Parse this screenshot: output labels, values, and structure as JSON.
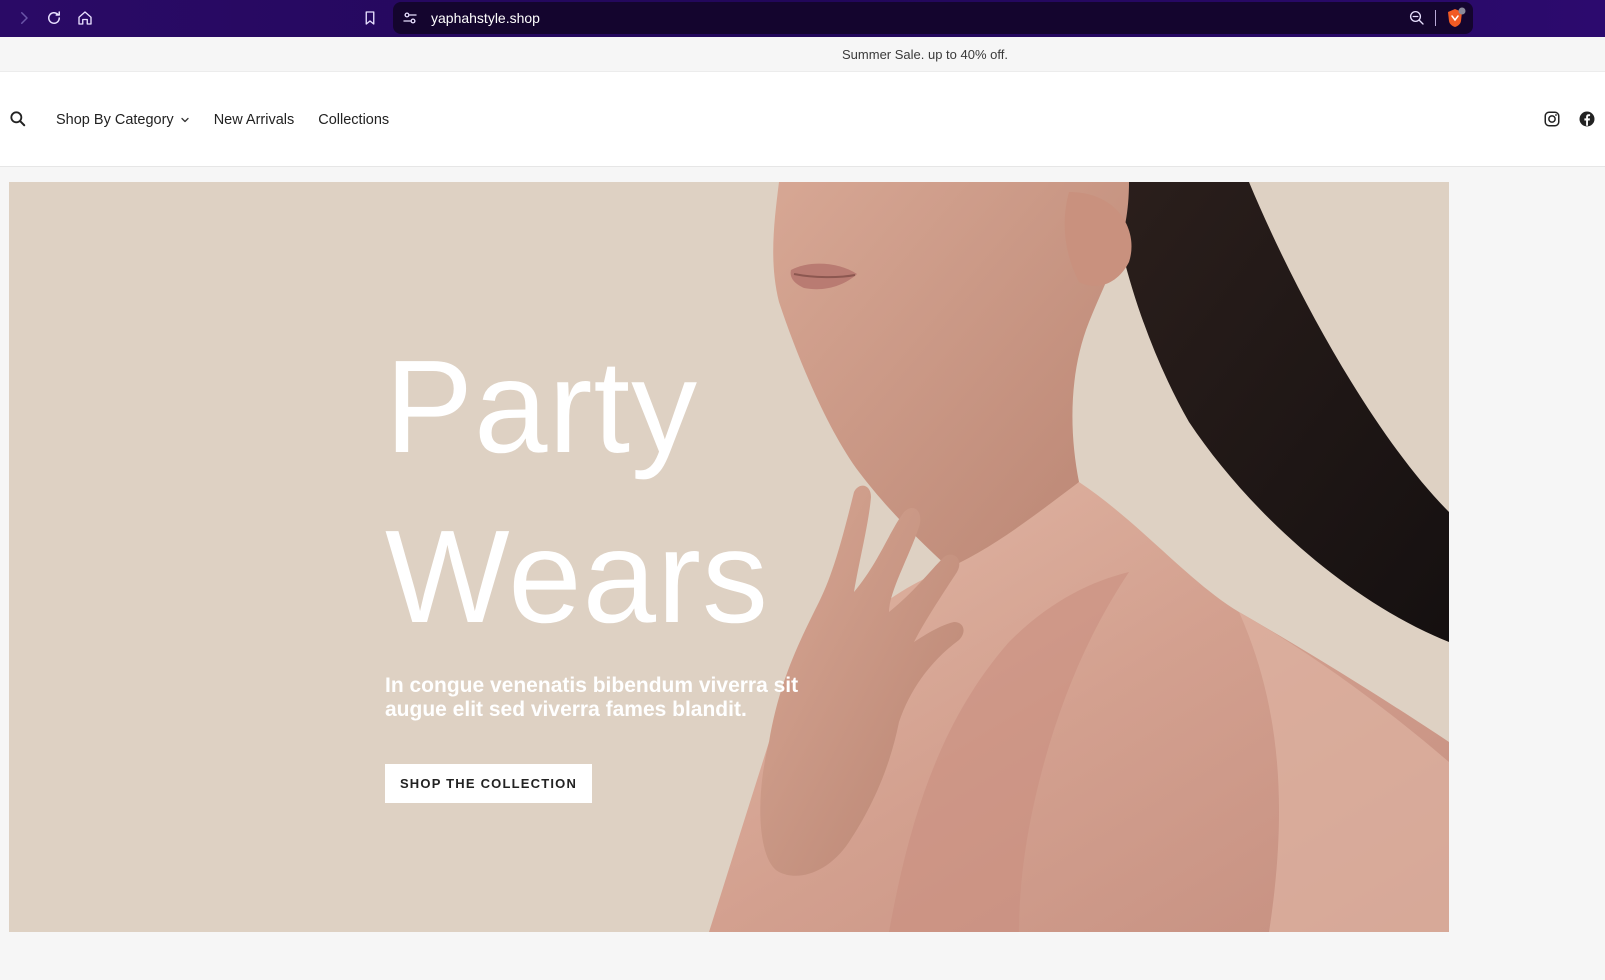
{
  "browser": {
    "url": "yaphahstyle.shop",
    "accent": "#2a0a66"
  },
  "announcement": {
    "text": "Summer Sale. up to 40% off."
  },
  "header": {
    "nav": [
      {
        "label": "Shop By Category",
        "has_dropdown": true
      },
      {
        "label": "New Arrivals"
      },
      {
        "label": "Collections"
      }
    ],
    "icons": [
      "search-icon",
      "instagram-icon",
      "facebook-icon"
    ]
  },
  "hero": {
    "title_line1": "Party",
    "title_line2": "Wears",
    "subtitle": "In congue venenatis bibendum viverra sit augue elit sed viverra fames blandit.",
    "cta_label": "SHOP THE COLLECTION",
    "background": "#ded1c3"
  }
}
